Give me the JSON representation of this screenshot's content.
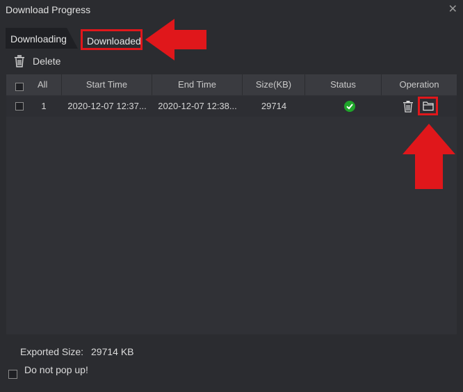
{
  "window": {
    "title": "Download Progress",
    "close_icon": "close-icon"
  },
  "tabs": {
    "downloading": "Downloading",
    "downloaded": "Downloaded"
  },
  "toolbar": {
    "delete_label": "Delete",
    "delete_icon": "trash-icon"
  },
  "table": {
    "headers": [
      "All",
      "Start Time",
      "End Time",
      "Size(KB)",
      "Status",
      "Operation"
    ],
    "rows": [
      {
        "index": "1",
        "start_time": "2020-12-07 12:37...",
        "end_time": "2020-12-07 12:38...",
        "size": "29714",
        "status_icon": "check-circle-icon",
        "operations": [
          "trash-icon",
          "folder-icon"
        ]
      }
    ]
  },
  "footer": {
    "exported_size_label": "Exported Size:",
    "exported_size_value": "29714 KB",
    "popup_label": "Do not pop up!"
  },
  "colors": {
    "background": "#2b2c30",
    "highlight": "#e0171b",
    "status_ok": "#1fa52a"
  }
}
